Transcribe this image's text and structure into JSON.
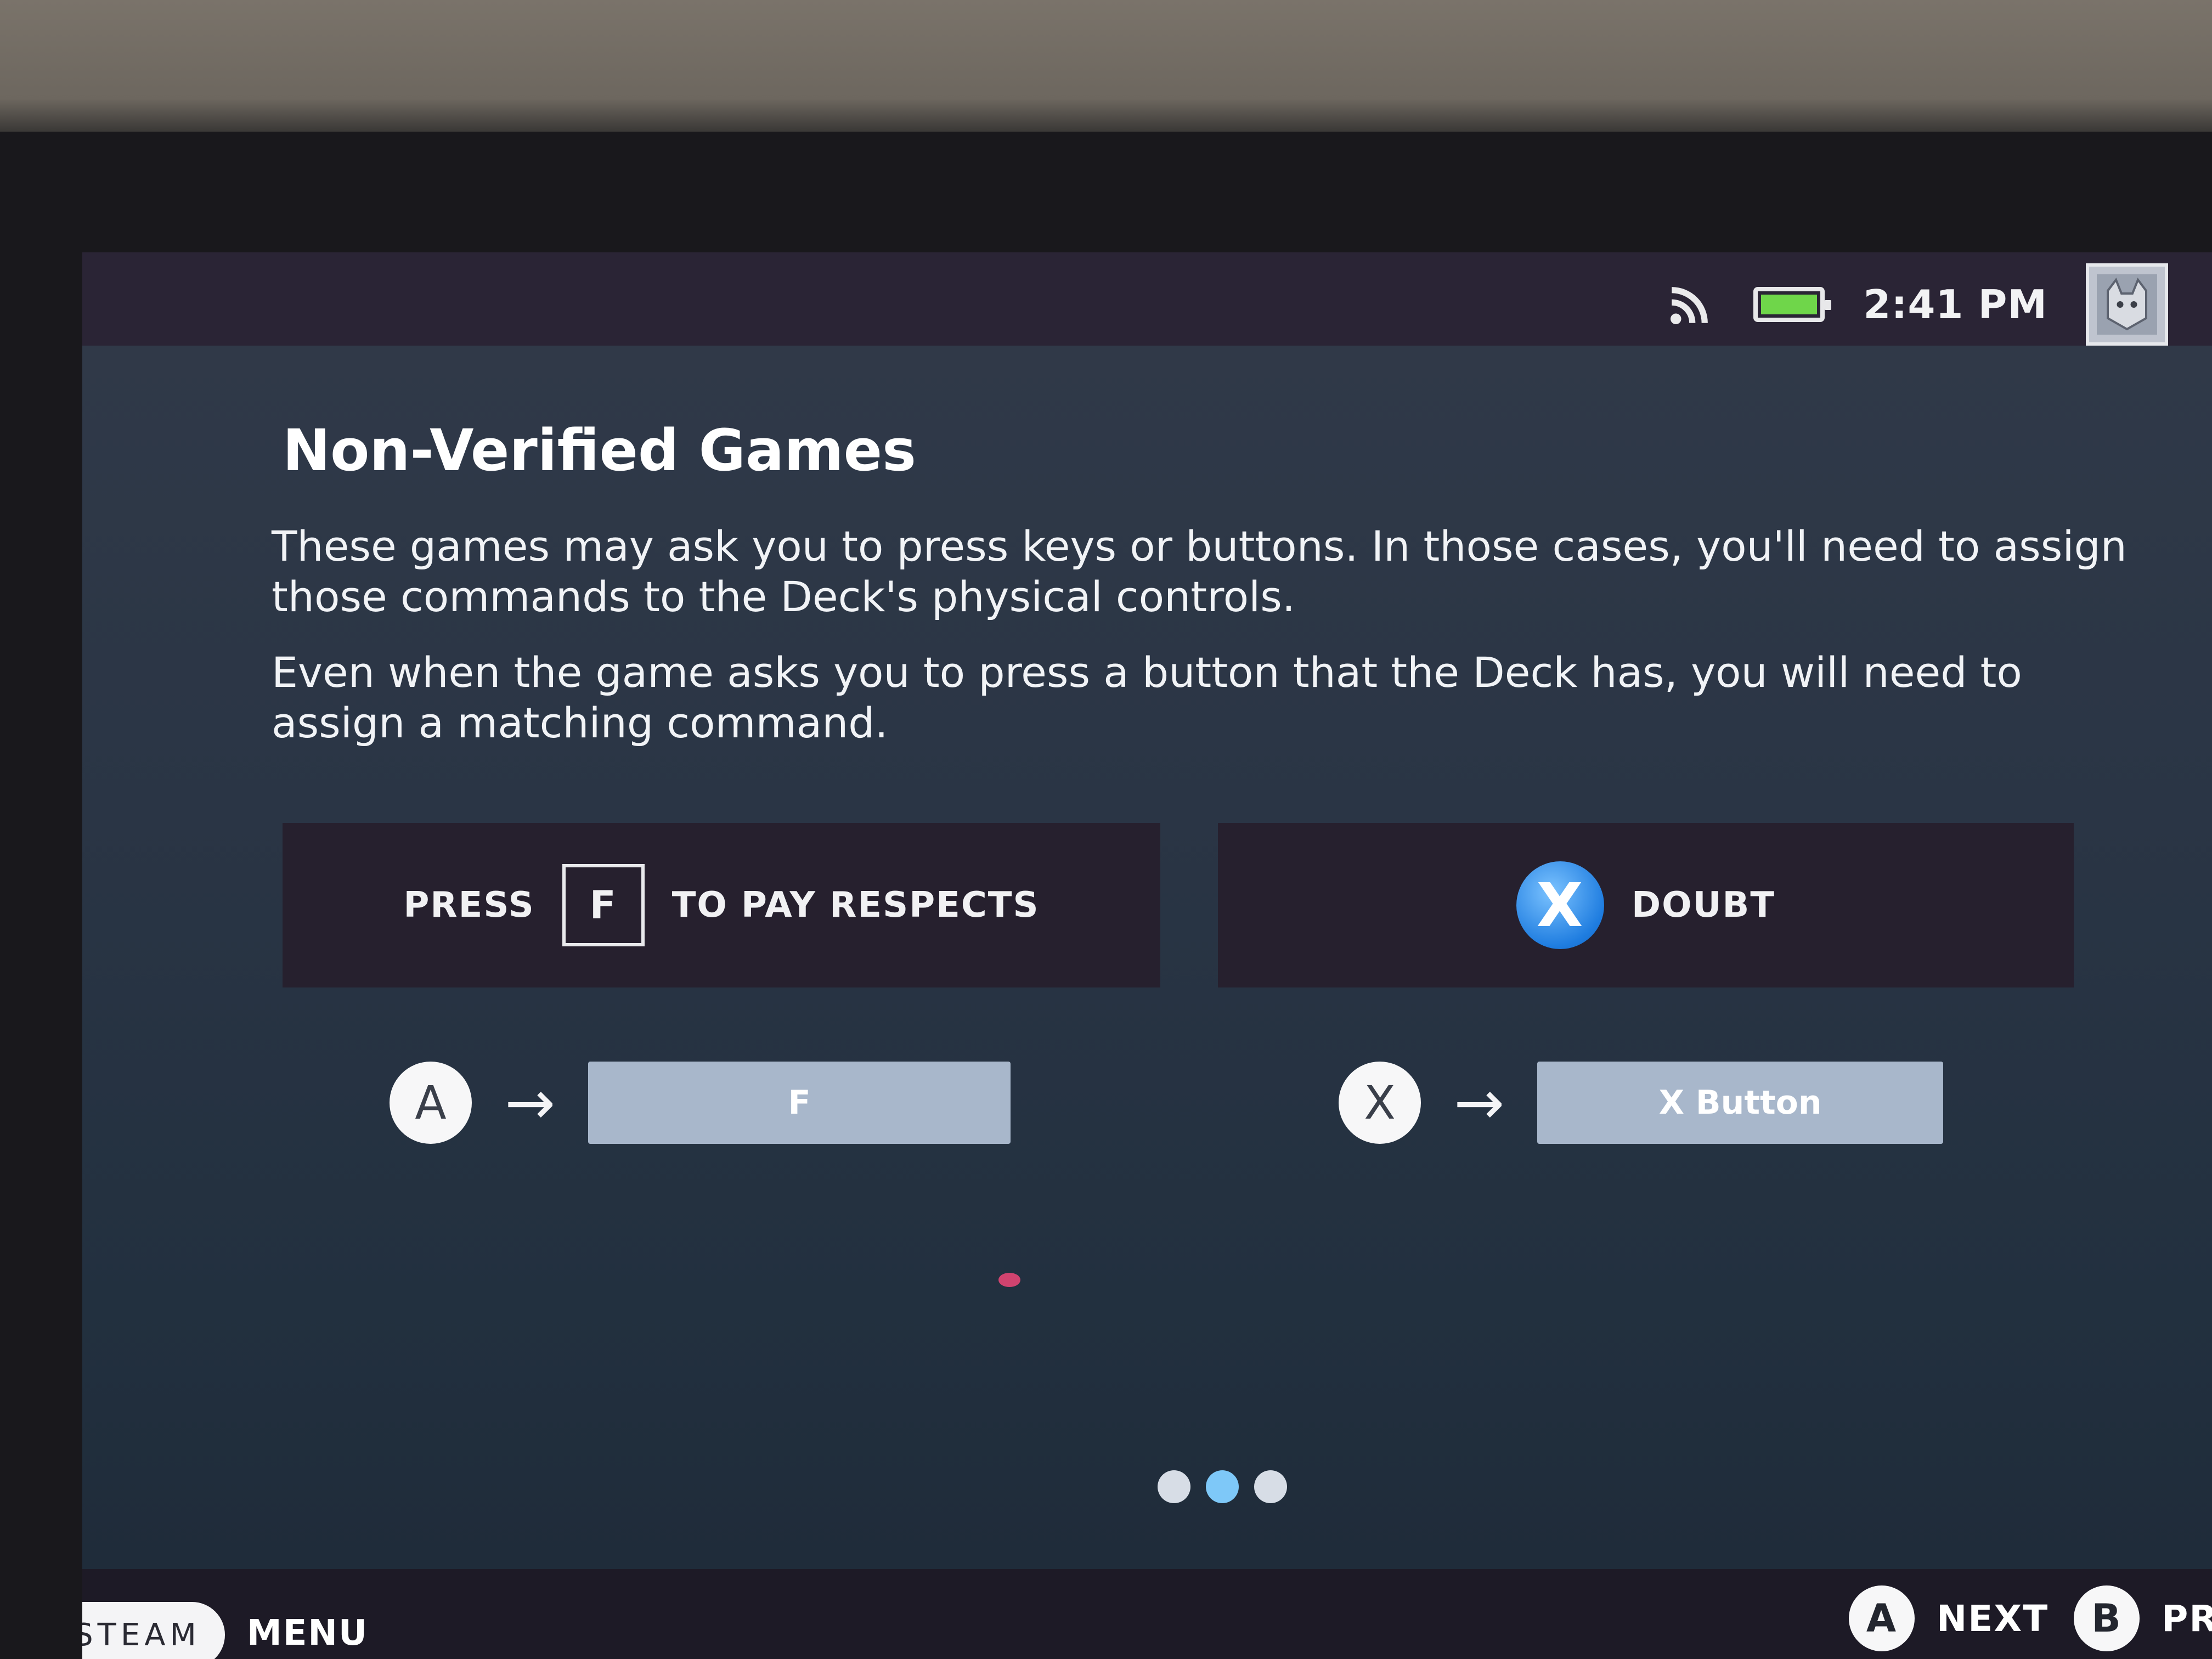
{
  "status_bar": {
    "time": "2:41 PM",
    "battery_level": 1.0,
    "icons": [
      "rss-icon",
      "battery-icon",
      "avatar-image"
    ]
  },
  "content": {
    "title": "Non-Verified Games",
    "paragraph1": "These games may ask you to press keys or buttons. In those cases, you'll need to assign those commands to the Deck's physical controls.",
    "paragraph2": "Even when the game asks you to press a button that the Deck has, you will need to assign a matching command."
  },
  "examples": {
    "left": {
      "press": "PRESS",
      "key": "F",
      "action": "TO PAY RESPECTS",
      "controller_button": "A",
      "arrow": "→",
      "assigned": "F"
    },
    "right": {
      "glyph": "X",
      "action": "DOUBT",
      "controller_button": "X",
      "arrow": "→",
      "assigned": "X Button"
    }
  },
  "pagination": {
    "pages": 3,
    "current": 2
  },
  "footer": {
    "steam_label": "STEAM",
    "menu_label": "MENU",
    "next_button": "A",
    "next_label": "NEXT",
    "prev_button": "B",
    "prev_label": "PRI"
  },
  "colors": {
    "battery_fill": "#6fd64a",
    "x_button_blue": "#1f7de0",
    "active_dot": "#7ec8f8"
  }
}
